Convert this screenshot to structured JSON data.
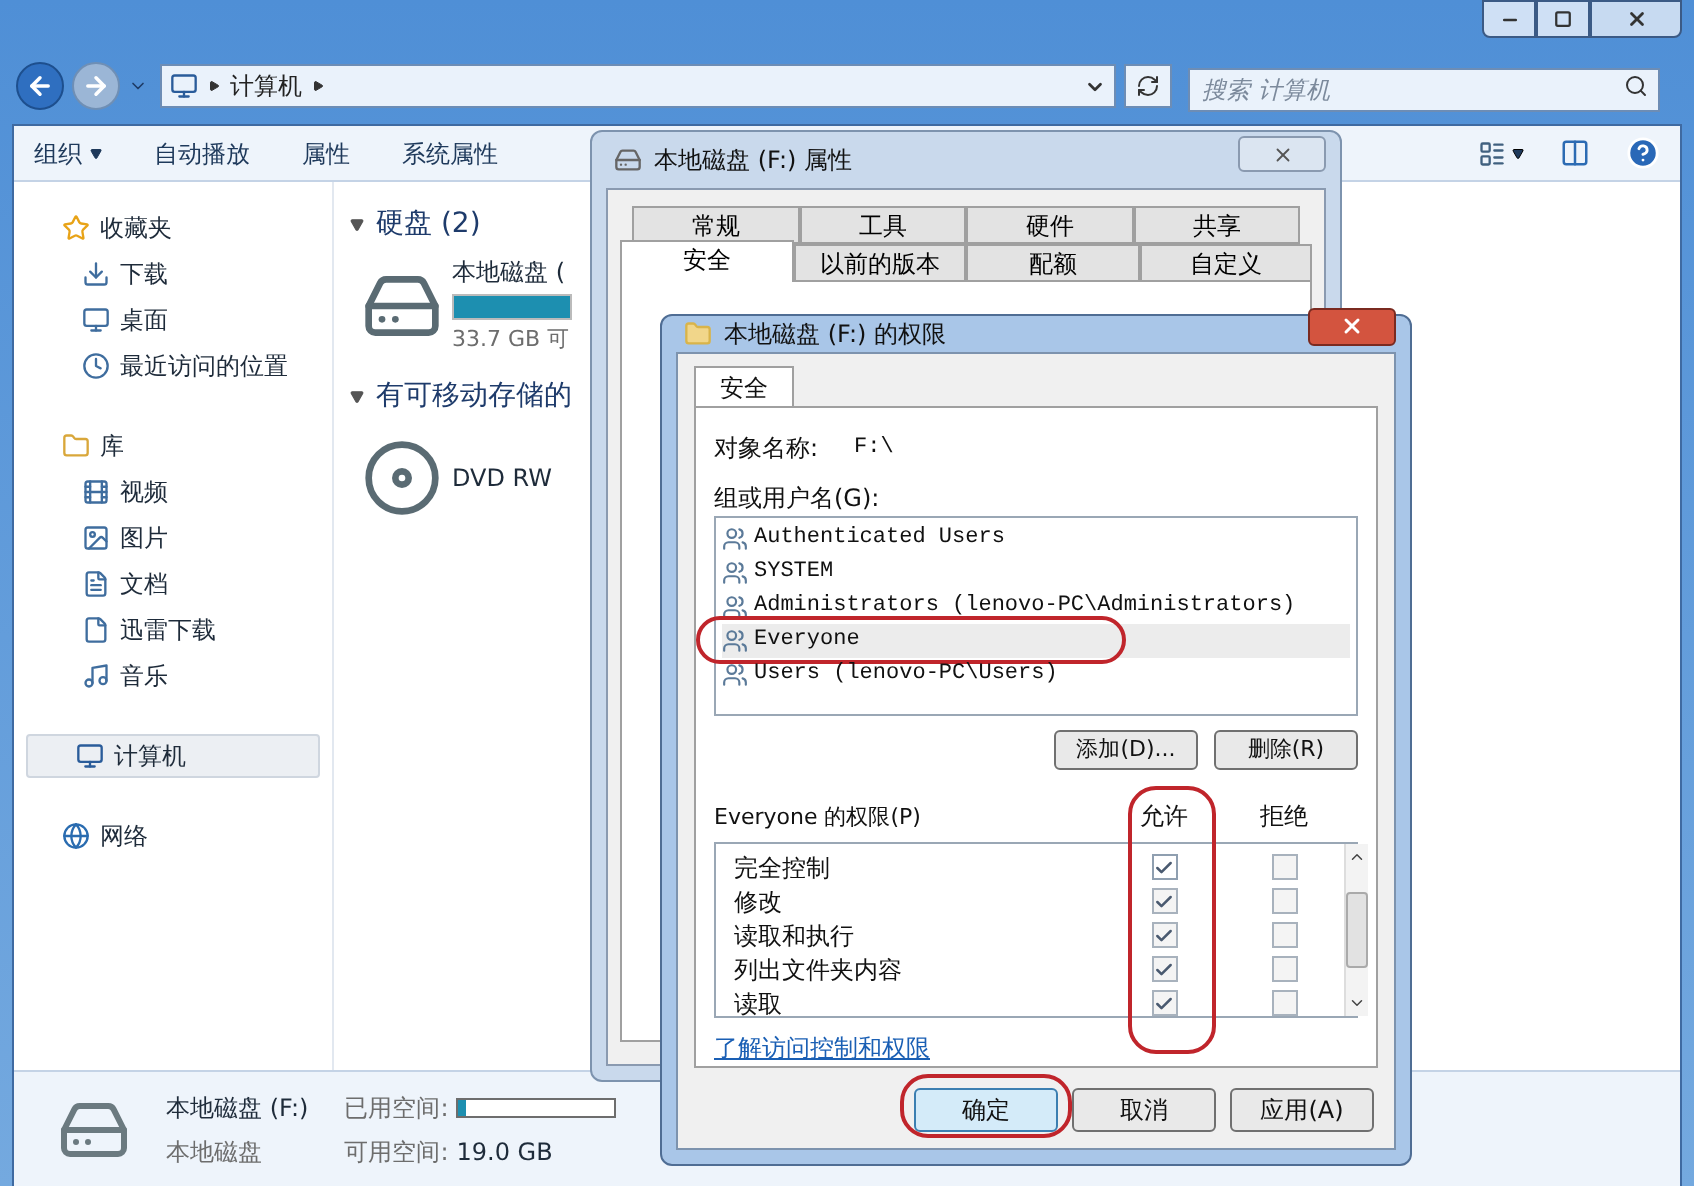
{
  "address_bar": {
    "path": [
      "计算机"
    ]
  },
  "search": {
    "placeholder": "搜索 计算机"
  },
  "toolbar": {
    "items": [
      {
        "label": "组织",
        "menu": true
      },
      {
        "label": "自动播放",
        "menu": false
      },
      {
        "label": "属性",
        "menu": false
      },
      {
        "label": "系统属性",
        "menu": false
      }
    ]
  },
  "nav_pane": {
    "groups": [
      {
        "label": "收藏夹",
        "selected": false,
        "children": [
          {
            "label": "下载",
            "selected": false
          },
          {
            "label": "桌面",
            "selected": false
          },
          {
            "label": "最近访问的位置",
            "selected": false
          }
        ]
      },
      {
        "label": "库",
        "selected": false,
        "children": [
          {
            "label": "视频",
            "selected": false
          },
          {
            "label": "图片",
            "selected": false
          },
          {
            "label": "文档",
            "selected": false
          },
          {
            "label": "迅雷下载",
            "selected": false
          },
          {
            "label": "音乐",
            "selected": false
          }
        ]
      },
      {
        "label": "计算机",
        "selected": true
      },
      {
        "label": "网络",
        "selected": false
      }
    ]
  },
  "content": {
    "sections": [
      {
        "title": "硬盘 (2)",
        "expanded": true,
        "items": [
          {
            "kind": "disk",
            "name": "本地磁盘 (",
            "detail": "33.7 GB 可",
            "meter": {
              "level": 1
            }
          }
        ]
      },
      {
        "title": "有可移动存储的",
        "expanded": true,
        "items": [
          {
            "kind": "dvd",
            "name": "DVD RW"
          }
        ]
      }
    ]
  },
  "status_bar": {
    "name": "本地磁盘 (F:)",
    "type": "本地磁盘",
    "used_label": "已用空间:",
    "used_meter": {
      "level": 0.05
    },
    "free_label": "可用空间:",
    "free_value": "19.0 GB"
  },
  "properties_dialog": {
    "title": "本地磁盘 (F:) 属性",
    "tab_rows": [
      [
        {
          "label": "常规",
          "selected": false
        },
        {
          "label": "工具",
          "selected": false
        },
        {
          "label": "硬件",
          "selected": false
        },
        {
          "label": "共享",
          "selected": false
        }
      ],
      [
        {
          "label": "安全",
          "selected": true
        },
        {
          "label": "以前的版本",
          "selected": false
        },
        {
          "label": "配额",
          "selected": false
        },
        {
          "label": "自定义",
          "selected": false
        }
      ]
    ]
  },
  "permissions_dialog": {
    "title": "本地磁盘 (F:) 的权限",
    "tabs": [
      {
        "label": "安全",
        "selected": true
      }
    ],
    "object_label": "对象名称:",
    "object_value": "F:\\",
    "users_label": "组或用户名(G):",
    "users": [
      {
        "name": "Authenticated Users",
        "selected": false,
        "circled": false
      },
      {
        "name": "SYSTEM",
        "selected": false,
        "circled": false
      },
      {
        "name": "Administrators (lenovo-PC\\Administrators)",
        "selected": false,
        "circled": false
      },
      {
        "name": "Everyone",
        "selected": true,
        "circled": true
      },
      {
        "name": "Users (lenovo-PC\\Users)",
        "selected": false,
        "circled": false
      }
    ],
    "user_buttons": [
      "添加(D)...",
      "删除(R)"
    ],
    "permissions_label": "Everyone 的权限(P)",
    "columns": [
      {
        "label": "允许",
        "circled": true
      },
      {
        "label": "拒绝",
        "circled": false
      }
    ],
    "rows": [
      {
        "label": "完全控制",
        "allow": true,
        "deny": false
      },
      {
        "label": "修改",
        "allow": true,
        "deny": false
      },
      {
        "label": "读取和执行",
        "allow": true,
        "deny": false
      },
      {
        "label": "列出文件夹内容",
        "allow": true,
        "deny": false
      },
      {
        "label": "读取",
        "allow": true,
        "deny": false
      }
    ],
    "link": "了解访问控制和权限",
    "buttons": [
      {
        "label": "确定",
        "default": true,
        "circled": true
      },
      {
        "label": "取消",
        "default": false,
        "circled": false
      },
      {
        "label": "应用(A)",
        "default": false,
        "circled": false
      }
    ]
  }
}
